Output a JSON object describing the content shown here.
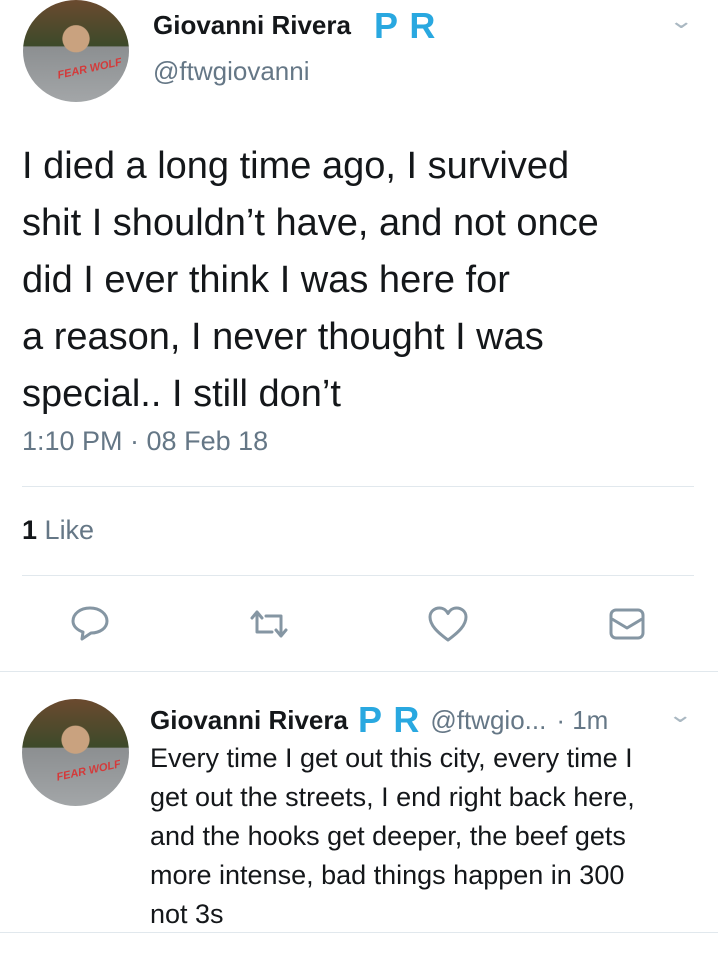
{
  "main_tweet": {
    "author_name": "Giovanni Rivera",
    "badge": "P R",
    "handle": "@ftwgiovanni",
    "text_lines": [
      "I died a long time ago, I survived",
      "shit I shouldn’t have, and not once",
      "did I ever think I was here for",
      "a reason, I never thought I was",
      "special.. I still don’t"
    ],
    "timestamp": "1:10 PM · 08 Feb 18",
    "likes_count": "1",
    "likes_label": "Like",
    "avatar_shirt_text": "FEAR WOLF"
  },
  "actions": {
    "reply_icon": "reply-icon",
    "retweet_icon": "retweet-icon",
    "like_icon": "heart-icon",
    "message_icon": "envelope-icon"
  },
  "reply_tweet": {
    "author_name": "Giovanni Rivera",
    "badge": "P R",
    "handle": "@ftwgio...",
    "time": "· 1m",
    "text_lines": [
      "Every time I get out this city, every time I",
      "get out the streets, I end right back here,",
      "and the hooks get deeper, the beef gets",
      "more intense, bad things happen in 300",
      "not 3s"
    ],
    "avatar_shirt_text": "FEAR WOLF"
  },
  "colors": {
    "text": "#14171a",
    "muted": "#657786",
    "badge": "#29a8e0",
    "divider": "#e1e8ed"
  }
}
